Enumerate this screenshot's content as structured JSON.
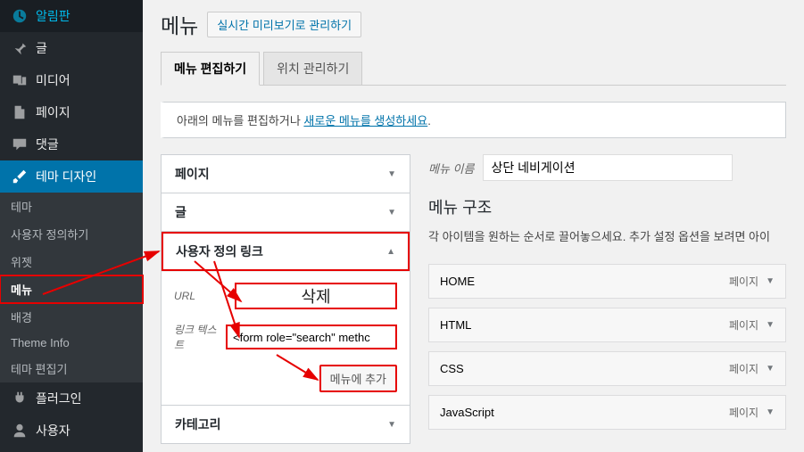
{
  "sidebar": {
    "items": [
      {
        "label": "알림판",
        "icon": "dashboard"
      },
      {
        "label": "글",
        "icon": "pin"
      },
      {
        "label": "미디어",
        "icon": "media"
      },
      {
        "label": "페이지",
        "icon": "page"
      },
      {
        "label": "댓글",
        "icon": "comment"
      },
      {
        "label": "테마 디자인",
        "icon": "brush",
        "active": true
      },
      {
        "label": "플러그인",
        "icon": "plugin"
      },
      {
        "label": "사용자",
        "icon": "user"
      }
    ],
    "subitems": [
      {
        "label": "테마"
      },
      {
        "label": "사용자 정의하기"
      },
      {
        "label": "위젯"
      },
      {
        "label": "메뉴",
        "current": true
      },
      {
        "label": "배경"
      },
      {
        "label": "Theme Info"
      },
      {
        "label": "테마 편집기"
      }
    ]
  },
  "header": {
    "title": "메뉴",
    "preview_button": "실시간 미리보기로 관리하기"
  },
  "tabs": [
    {
      "label": "메뉴 편집하기",
      "active": true
    },
    {
      "label": "위치 관리하기"
    }
  ],
  "notice": {
    "text_before": "아래의 메뉴를 편집하거나 ",
    "link": "새로운 메뉴를 생성하세요",
    "text_after": "."
  },
  "accordions": [
    {
      "label": "페이지",
      "open": false
    },
    {
      "label": "글",
      "open": false
    },
    {
      "label": "사용자 정의 링크",
      "open": true
    },
    {
      "label": "카테고리",
      "open": false
    }
  ],
  "custom_link": {
    "url_label": "URL",
    "url_display": "삭제",
    "text_label": "링크 텍스트",
    "text_value": "<form role=\"search\" methc",
    "add_button": "메뉴에 추가"
  },
  "menu_name": {
    "label": "메뉴 이름",
    "value": "상단 네비게이션"
  },
  "structure": {
    "title": "메뉴 구조",
    "desc": "각 아이템을 원하는 순서로 끌어놓으세요. 추가 설정 옵션을 보려면 아이"
  },
  "menu_items": [
    {
      "label": "HOME",
      "type": "페이지"
    },
    {
      "label": "HTML",
      "type": "페이지"
    },
    {
      "label": "CSS",
      "type": "페이지"
    },
    {
      "label": "JavaScript",
      "type": "페이지"
    }
  ]
}
